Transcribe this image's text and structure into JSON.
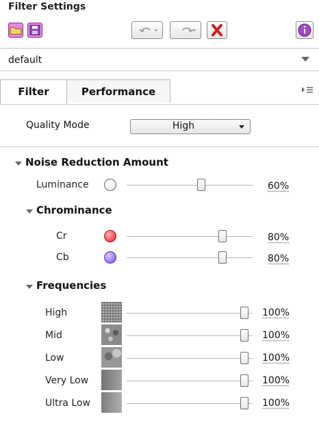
{
  "panel": {
    "title": "Filter Settings",
    "preset": {
      "value": "default"
    },
    "toolbar": {
      "icons": [
        "folder-icon",
        "save-icon",
        "undo-icon",
        "redo-icon",
        "clear-icon",
        "info-icon"
      ]
    },
    "tabs": [
      {
        "label": "Filter",
        "active": true
      },
      {
        "label": "Performance",
        "active": false
      }
    ],
    "quality": {
      "label": "Quality Mode",
      "value": "High"
    },
    "noise_reduction": {
      "title": "Noise Reduction Amount",
      "luminance": {
        "label": "Luminance",
        "value": "60%",
        "level": 0.6
      },
      "chrominance": {
        "title": "Chrominance",
        "cr": {
          "label": "Cr",
          "value": "80%",
          "level": 0.8,
          "color": "#ef4b4b"
        },
        "cb": {
          "label": "Cb",
          "value": "80%",
          "level": 0.8,
          "color": "#8f6ff2"
        }
      },
      "frequencies": {
        "title": "Frequencies",
        "items": [
          {
            "label": "High",
            "value": "100%",
            "level": 1.0
          },
          {
            "label": "Mid",
            "value": "100%",
            "level": 1.0
          },
          {
            "label": "Low",
            "value": "100%",
            "level": 1.0
          },
          {
            "label": "Very Low",
            "value": "100%",
            "level": 1.0
          },
          {
            "label": "Ultra Low",
            "value": "100%",
            "level": 1.0
          }
        ]
      }
    }
  }
}
